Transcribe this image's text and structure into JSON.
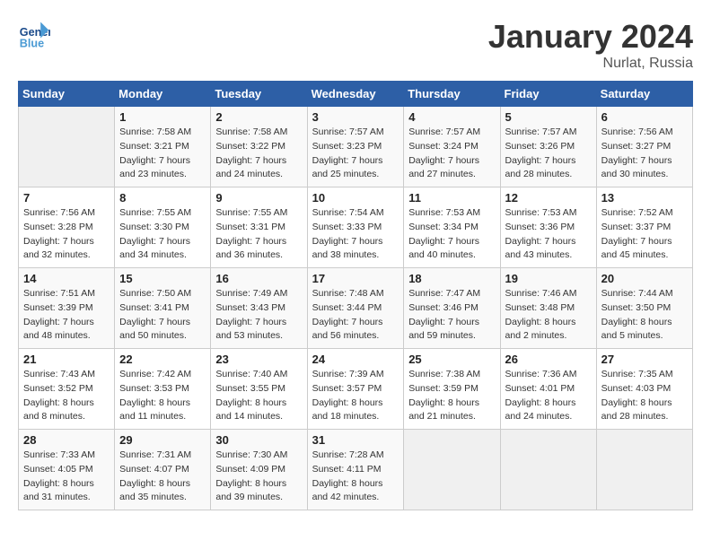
{
  "header": {
    "logo_general": "General",
    "logo_blue": "Blue",
    "month_title": "January 2024",
    "location": "Nurlat, Russia"
  },
  "weekdays": [
    "Sunday",
    "Monday",
    "Tuesday",
    "Wednesday",
    "Thursday",
    "Friday",
    "Saturday"
  ],
  "weeks": [
    [
      {
        "day": "",
        "sunrise": "",
        "sunset": "",
        "daylight": ""
      },
      {
        "day": "1",
        "sunrise": "Sunrise: 7:58 AM",
        "sunset": "Sunset: 3:21 PM",
        "daylight": "Daylight: 7 hours and 23 minutes."
      },
      {
        "day": "2",
        "sunrise": "Sunrise: 7:58 AM",
        "sunset": "Sunset: 3:22 PM",
        "daylight": "Daylight: 7 hours and 24 minutes."
      },
      {
        "day": "3",
        "sunrise": "Sunrise: 7:57 AM",
        "sunset": "Sunset: 3:23 PM",
        "daylight": "Daylight: 7 hours and 25 minutes."
      },
      {
        "day": "4",
        "sunrise": "Sunrise: 7:57 AM",
        "sunset": "Sunset: 3:24 PM",
        "daylight": "Daylight: 7 hours and 27 minutes."
      },
      {
        "day": "5",
        "sunrise": "Sunrise: 7:57 AM",
        "sunset": "Sunset: 3:26 PM",
        "daylight": "Daylight: 7 hours and 28 minutes."
      },
      {
        "day": "6",
        "sunrise": "Sunrise: 7:56 AM",
        "sunset": "Sunset: 3:27 PM",
        "daylight": "Daylight: 7 hours and 30 minutes."
      }
    ],
    [
      {
        "day": "7",
        "sunrise": "Sunrise: 7:56 AM",
        "sunset": "Sunset: 3:28 PM",
        "daylight": "Daylight: 7 hours and 32 minutes."
      },
      {
        "day": "8",
        "sunrise": "Sunrise: 7:55 AM",
        "sunset": "Sunset: 3:30 PM",
        "daylight": "Daylight: 7 hours and 34 minutes."
      },
      {
        "day": "9",
        "sunrise": "Sunrise: 7:55 AM",
        "sunset": "Sunset: 3:31 PM",
        "daylight": "Daylight: 7 hours and 36 minutes."
      },
      {
        "day": "10",
        "sunrise": "Sunrise: 7:54 AM",
        "sunset": "Sunset: 3:33 PM",
        "daylight": "Daylight: 7 hours and 38 minutes."
      },
      {
        "day": "11",
        "sunrise": "Sunrise: 7:53 AM",
        "sunset": "Sunset: 3:34 PM",
        "daylight": "Daylight: 7 hours and 40 minutes."
      },
      {
        "day": "12",
        "sunrise": "Sunrise: 7:53 AM",
        "sunset": "Sunset: 3:36 PM",
        "daylight": "Daylight: 7 hours and 43 minutes."
      },
      {
        "day": "13",
        "sunrise": "Sunrise: 7:52 AM",
        "sunset": "Sunset: 3:37 PM",
        "daylight": "Daylight: 7 hours and 45 minutes."
      }
    ],
    [
      {
        "day": "14",
        "sunrise": "Sunrise: 7:51 AM",
        "sunset": "Sunset: 3:39 PM",
        "daylight": "Daylight: 7 hours and 48 minutes."
      },
      {
        "day": "15",
        "sunrise": "Sunrise: 7:50 AM",
        "sunset": "Sunset: 3:41 PM",
        "daylight": "Daylight: 7 hours and 50 minutes."
      },
      {
        "day": "16",
        "sunrise": "Sunrise: 7:49 AM",
        "sunset": "Sunset: 3:43 PM",
        "daylight": "Daylight: 7 hours and 53 minutes."
      },
      {
        "day": "17",
        "sunrise": "Sunrise: 7:48 AM",
        "sunset": "Sunset: 3:44 PM",
        "daylight": "Daylight: 7 hours and 56 minutes."
      },
      {
        "day": "18",
        "sunrise": "Sunrise: 7:47 AM",
        "sunset": "Sunset: 3:46 PM",
        "daylight": "Daylight: 7 hours and 59 minutes."
      },
      {
        "day": "19",
        "sunrise": "Sunrise: 7:46 AM",
        "sunset": "Sunset: 3:48 PM",
        "daylight": "Daylight: 8 hours and 2 minutes."
      },
      {
        "day": "20",
        "sunrise": "Sunrise: 7:44 AM",
        "sunset": "Sunset: 3:50 PM",
        "daylight": "Daylight: 8 hours and 5 minutes."
      }
    ],
    [
      {
        "day": "21",
        "sunrise": "Sunrise: 7:43 AM",
        "sunset": "Sunset: 3:52 PM",
        "daylight": "Daylight: 8 hours and 8 minutes."
      },
      {
        "day": "22",
        "sunrise": "Sunrise: 7:42 AM",
        "sunset": "Sunset: 3:53 PM",
        "daylight": "Daylight: 8 hours and 11 minutes."
      },
      {
        "day": "23",
        "sunrise": "Sunrise: 7:40 AM",
        "sunset": "Sunset: 3:55 PM",
        "daylight": "Daylight: 8 hours and 14 minutes."
      },
      {
        "day": "24",
        "sunrise": "Sunrise: 7:39 AM",
        "sunset": "Sunset: 3:57 PM",
        "daylight": "Daylight: 8 hours and 18 minutes."
      },
      {
        "day": "25",
        "sunrise": "Sunrise: 7:38 AM",
        "sunset": "Sunset: 3:59 PM",
        "daylight": "Daylight: 8 hours and 21 minutes."
      },
      {
        "day": "26",
        "sunrise": "Sunrise: 7:36 AM",
        "sunset": "Sunset: 4:01 PM",
        "daylight": "Daylight: 8 hours and 24 minutes."
      },
      {
        "day": "27",
        "sunrise": "Sunrise: 7:35 AM",
        "sunset": "Sunset: 4:03 PM",
        "daylight": "Daylight: 8 hours and 28 minutes."
      }
    ],
    [
      {
        "day": "28",
        "sunrise": "Sunrise: 7:33 AM",
        "sunset": "Sunset: 4:05 PM",
        "daylight": "Daylight: 8 hours and 31 minutes."
      },
      {
        "day": "29",
        "sunrise": "Sunrise: 7:31 AM",
        "sunset": "Sunset: 4:07 PM",
        "daylight": "Daylight: 8 hours and 35 minutes."
      },
      {
        "day": "30",
        "sunrise": "Sunrise: 7:30 AM",
        "sunset": "Sunset: 4:09 PM",
        "daylight": "Daylight: 8 hours and 39 minutes."
      },
      {
        "day": "31",
        "sunrise": "Sunrise: 7:28 AM",
        "sunset": "Sunset: 4:11 PM",
        "daylight": "Daylight: 8 hours and 42 minutes."
      },
      {
        "day": "",
        "sunrise": "",
        "sunset": "",
        "daylight": ""
      },
      {
        "day": "",
        "sunrise": "",
        "sunset": "",
        "daylight": ""
      },
      {
        "day": "",
        "sunrise": "",
        "sunset": "",
        "daylight": ""
      }
    ]
  ]
}
